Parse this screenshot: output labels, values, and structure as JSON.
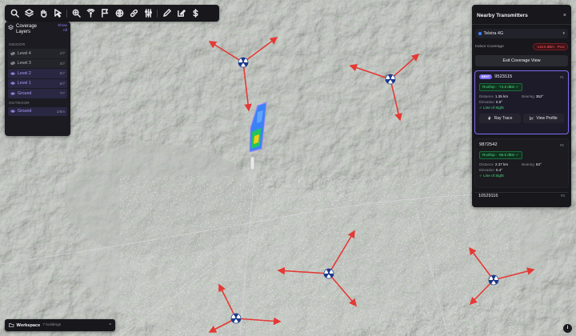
{
  "toolbar": {
    "tools": [
      "search-icon",
      "layers-icon",
      "hand-icon",
      "cursor-icon",
      "zoom-icon",
      "signal-icon",
      "flag-icon",
      "globe-icon",
      "link-icon",
      "sliders-icon",
      "pen-icon",
      "edit-icon",
      "dollar-icon"
    ]
  },
  "layers": {
    "title": "Coverage Layers",
    "show_all": "Show All",
    "indoor_label": "INDOOR",
    "outdoor_label": "OUTDOOR",
    "indoor": [
      {
        "name": "Level 4",
        "count": "1/7",
        "visible": false
      },
      {
        "name": "Level 3",
        "count": "4/7",
        "visible": false
      },
      {
        "name": "Level 2",
        "count": "5/7",
        "visible": true
      },
      {
        "name": "Level 1",
        "count": "6/7",
        "visible": true
      },
      {
        "name": "Ground",
        "count": "7/7",
        "visible": true
      }
    ],
    "outdoor": [
      {
        "name": "Ground",
        "count": "1/5m",
        "visible": true
      }
    ]
  },
  "transmitters": {
    "title": "Nearby Transmitters",
    "close": "×",
    "network": "Telstra 4G",
    "indoor_label": "Indoor Coverage",
    "indoor_value": "-115.5 dBm · Poor",
    "exit_label": "Exit Coverage View",
    "cards": [
      {
        "best": "BEST",
        "id": "9523115",
        "rank": "#1",
        "signal": "Rooftop · -74.8 dBm ✓",
        "distance_label": "Distance",
        "distance": "1.35 km",
        "bearing_label": "Bearing",
        "bearing": "352°",
        "elev_label": "Elevation",
        "elev": "0.9°",
        "los": "✓ Line of Sight",
        "ray_trace": "Ray Trace",
        "view_profile": "View Profile"
      },
      {
        "id": "9872542",
        "rank": "#2",
        "signal": "Rooftop · -86.5 dBm ✓",
        "distance_label": "Distance",
        "distance": "2.37 km",
        "bearing_label": "Bearing",
        "bearing": "63°",
        "elev_label": "Elevation",
        "elev": "0.4°",
        "los": "✓ Line of Sight"
      }
    ],
    "peek_id": "10529116",
    "peek_rank": "#3"
  },
  "workspace": {
    "label": "Workspace",
    "sub": "7 buildings",
    "chev": "^"
  },
  "info": "i",
  "colors": {
    "accent": "#7c6cf2",
    "arrow": "#e53935",
    "good": "#4ade80",
    "poor": "#ff5a5f"
  }
}
